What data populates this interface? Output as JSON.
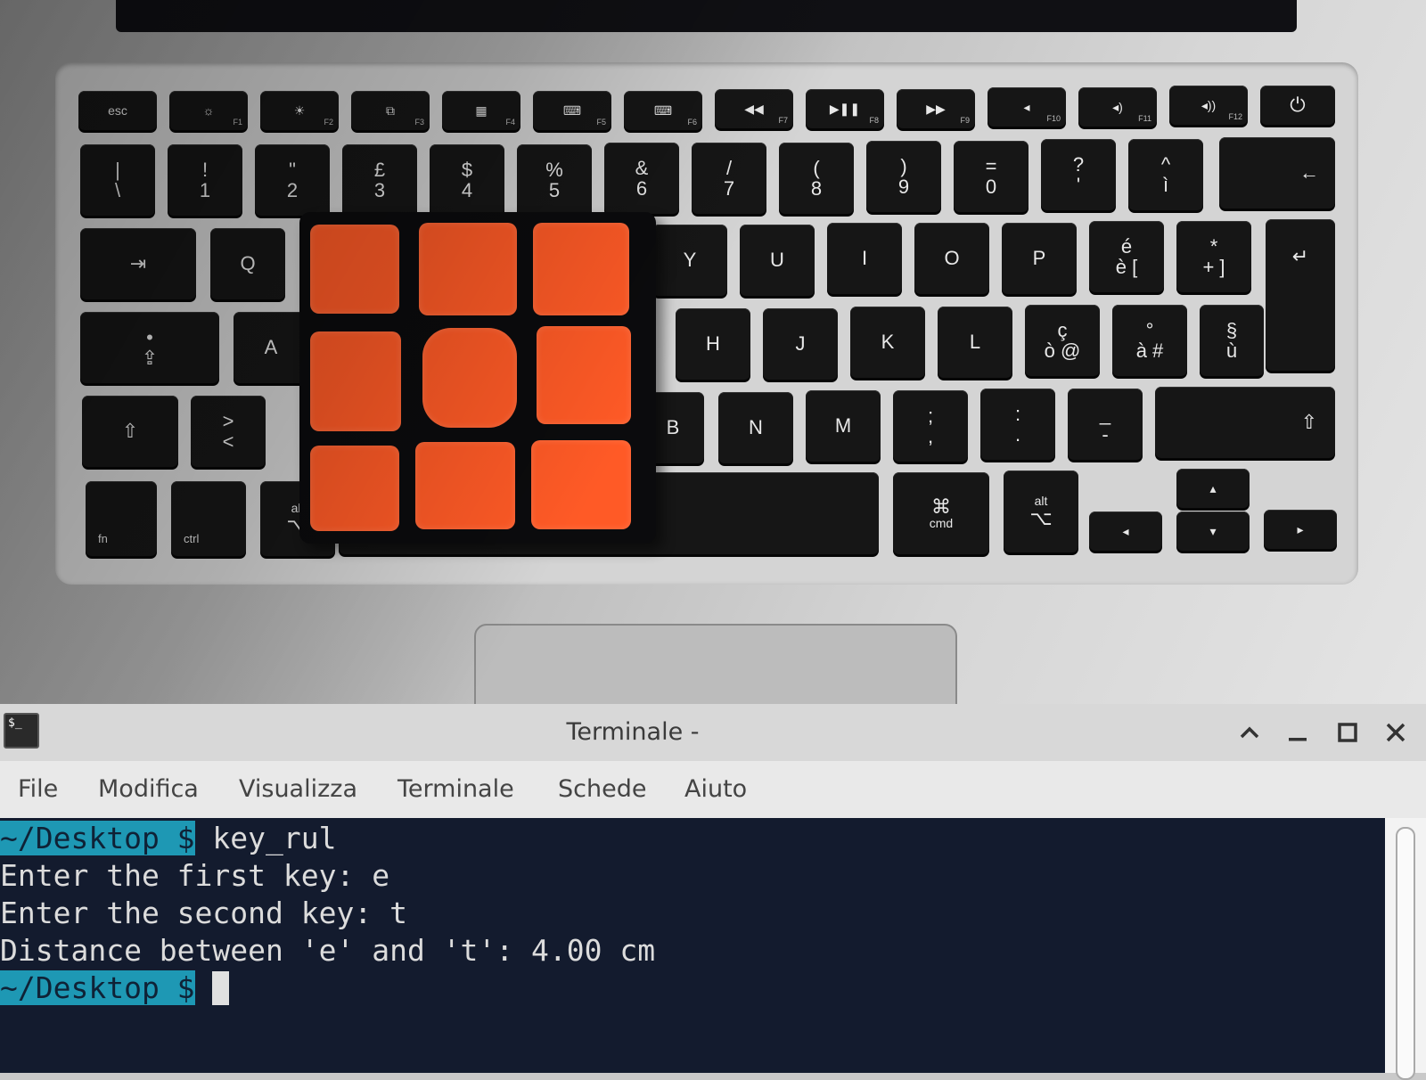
{
  "photo": {
    "function_keys": [
      {
        "main": "esc",
        "fn": ""
      },
      {
        "main": "☼",
        "fn": "F1"
      },
      {
        "main": "☀",
        "fn": "F2"
      },
      {
        "main": "⧉",
        "fn": "F3"
      },
      {
        "main": "▦",
        "fn": "F4"
      },
      {
        "main": "⌨",
        "fn": "F5"
      },
      {
        "main": "⌨",
        "fn": "F6"
      },
      {
        "main": "◀◀",
        "fn": "F7"
      },
      {
        "main": "▶❚❚",
        "fn": "F8"
      },
      {
        "main": "▶▶",
        "fn": "F9"
      },
      {
        "main": "◂",
        "fn": "F10"
      },
      {
        "main": "◂)",
        "fn": "F11"
      },
      {
        "main": "◂))",
        "fn": "F12"
      },
      {
        "main": "⏻",
        "fn": ""
      }
    ],
    "number_row": [
      {
        "top": "|",
        "bottom": "\\"
      },
      {
        "top": "!",
        "bottom": "1"
      },
      {
        "top": "\"",
        "bottom": "2"
      },
      {
        "top": "£",
        "bottom": "3"
      },
      {
        "top": "$",
        "bottom": "4"
      },
      {
        "top": "%",
        "bottom": "5"
      },
      {
        "top": "&",
        "bottom": "6"
      },
      {
        "top": "/",
        "bottom": "7"
      },
      {
        "top": "(",
        "bottom": "8"
      },
      {
        "top": ")",
        "bottom": "9"
      },
      {
        "top": "=",
        "bottom": "0"
      },
      {
        "top": "?",
        "bottom": "'"
      },
      {
        "top": "^",
        "bottom": "ì"
      },
      {
        "top": "",
        "bottom": "←"
      }
    ],
    "row_q": [
      {
        "top": "",
        "bottom": "⇥"
      },
      {
        "top": "",
        "bottom": "Q"
      },
      {
        "top": "",
        "bottom": "Y"
      },
      {
        "top": "",
        "bottom": "U"
      },
      {
        "top": "",
        "bottom": "I"
      },
      {
        "top": "",
        "bottom": "O"
      },
      {
        "top": "",
        "bottom": "P"
      },
      {
        "top": "é",
        "bottom": "è ["
      },
      {
        "top": "*",
        "bottom": "+ ]"
      },
      {
        "top": "",
        "bottom": "↵"
      }
    ],
    "row_a": [
      {
        "top": "•",
        "bottom": "⇪"
      },
      {
        "top": "",
        "bottom": "A"
      },
      {
        "top": "",
        "bottom": "H"
      },
      {
        "top": "",
        "bottom": "J"
      },
      {
        "top": "",
        "bottom": "K"
      },
      {
        "top": "",
        "bottom": "L"
      },
      {
        "top": "ç",
        "bottom": "ò @"
      },
      {
        "top": "°",
        "bottom": "à #"
      },
      {
        "top": "§",
        "bottom": "ù"
      }
    ],
    "row_z": [
      {
        "top": "",
        "bottom": "⇧"
      },
      {
        "top": ">",
        "bottom": "<"
      },
      {
        "top": "",
        "bottom": "B"
      },
      {
        "top": "",
        "bottom": "N"
      },
      {
        "top": "",
        "bottom": "M"
      },
      {
        "top": ";",
        "bottom": ","
      },
      {
        "top": ":",
        "bottom": "."
      },
      {
        "top": "_",
        "bottom": "-"
      },
      {
        "top": "",
        "bottom": "⇧"
      }
    ],
    "row_bottom": [
      {
        "top": "",
        "bottom": "fn"
      },
      {
        "top": "",
        "bottom": "ctrl"
      },
      {
        "top": "alt",
        "bottom": "⌥"
      },
      {
        "top": "⌘",
        "bottom": "cmd"
      },
      {
        "top": "alt",
        "bottom": "⌥"
      },
      {
        "top": "",
        "bottom": "◂"
      },
      {
        "top": "",
        "bottom": "▴"
      },
      {
        "top": "",
        "bottom": "▾"
      },
      {
        "top": "",
        "bottom": "▸"
      }
    ],
    "cube_color": "#ff5a26",
    "cube_side_color": "#1747b3"
  },
  "window": {
    "app_icon_text": "$_",
    "title": "Terminale -",
    "controls": [
      "▲",
      "_",
      "☐",
      "✕"
    ]
  },
  "menu": [
    "File",
    "Modifica",
    "Visualizza",
    "Terminale",
    "Schede",
    "Aiuto"
  ],
  "terminal": {
    "prompt": "~/Desktop $",
    "command": " key_rul",
    "lines": [
      "Enter the first key: e",
      "Enter the second key: t",
      "Distance between 'e' and 't': 4.00 cm"
    ],
    "prompt2": "~/Desktop $",
    "colors": {
      "background": "#131b2e",
      "prompt_bg": "#1e98b4",
      "text": "#dcdcdc"
    }
  }
}
